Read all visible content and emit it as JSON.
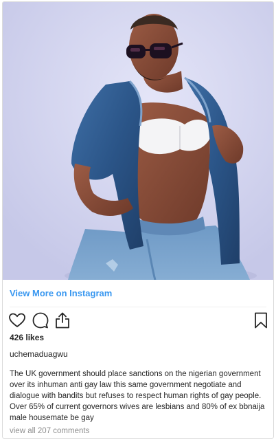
{
  "post": {
    "image_alt": "photo of a man in sunglasses and denim jacket",
    "view_more_label": "View More on Instagram",
    "likes_text": "426 likes",
    "username": "uchemaduagwu",
    "caption": "The UK government should place sanctions on the nigerian government over its inhuman anti gay law this same government negotiate and dialogue with bandits but refuses to respect human rights of gay people. Over 65% of current governors wives are lesbians and 80% of ex bbnaija male housemate be gay",
    "comments_link": "view all 207 comments"
  },
  "colors": {
    "link_blue": "#3897f0",
    "text_dark": "#262626",
    "text_muted": "#8e8e8e",
    "border": "#dbdbdb",
    "photo_background": "#d2d3f0"
  },
  "icons": {
    "like": "heart-icon",
    "comment": "comment-icon",
    "share": "share-icon",
    "save": "bookmark-icon"
  }
}
